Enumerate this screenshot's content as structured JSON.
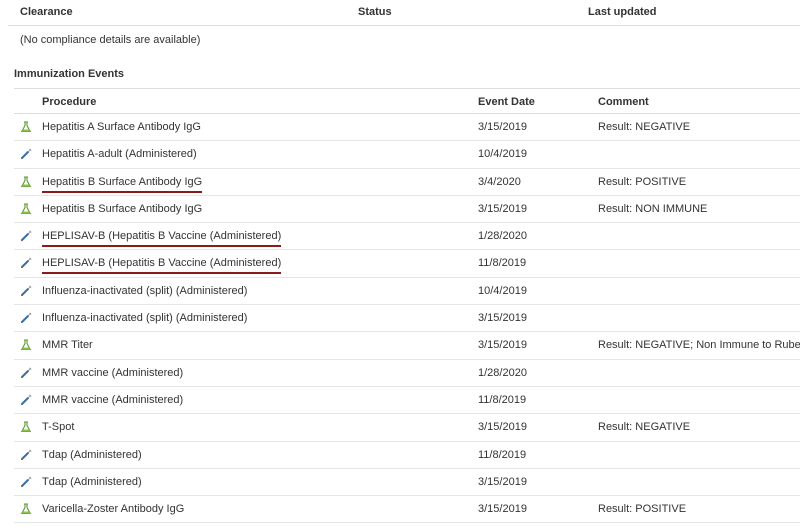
{
  "clearance": {
    "headers": {
      "clearance": "Clearance",
      "status": "Status",
      "last_updated": "Last updated"
    },
    "empty_message": "(No compliance details are available)"
  },
  "immunization": {
    "title": "Immunization Events",
    "headers": {
      "procedure": "Procedure",
      "event_date": "Event Date",
      "comment": "Comment"
    },
    "rows": [
      {
        "icon": "flask-icon",
        "procedure": "Hepatitis A Surface Antibody IgG",
        "date": "3/15/2019",
        "comment": "Result: NEGATIVE",
        "underlined": false
      },
      {
        "icon": "syringe-icon",
        "procedure": "Hepatitis A-adult (Administered)",
        "date": "10/4/2019",
        "comment": "",
        "underlined": false
      },
      {
        "icon": "flask-icon",
        "procedure": "Hepatitis B Surface Antibody IgG",
        "date": "3/4/2020",
        "comment": "Result: POSITIVE",
        "underlined": true
      },
      {
        "icon": "flask-icon",
        "procedure": "Hepatitis B Surface Antibody IgG",
        "date": "3/15/2019",
        "comment": "Result: NON IMMUNE",
        "underlined": false
      },
      {
        "icon": "syringe-icon",
        "procedure": "HEPLISAV-B (Hepatitis B Vaccine (Administered)",
        "date": "1/28/2020",
        "comment": "",
        "underlined": true
      },
      {
        "icon": "syringe-icon",
        "procedure": "HEPLISAV-B (Hepatitis B Vaccine (Administered)",
        "date": "11/8/2019",
        "comment": "",
        "underlined": true
      },
      {
        "icon": "syringe-icon",
        "procedure": "Influenza-inactivated (split) (Administered)",
        "date": "10/4/2019",
        "comment": "",
        "underlined": false
      },
      {
        "icon": "syringe-icon",
        "procedure": "Influenza-inactivated (split) (Administered)",
        "date": "3/15/2019",
        "comment": "",
        "underlined": false
      },
      {
        "icon": "flask-icon",
        "procedure": "MMR Titer",
        "date": "3/15/2019",
        "comment": "Result: NEGATIVE; Non Immune to Rubeola",
        "underlined": false
      },
      {
        "icon": "syringe-icon",
        "procedure": "MMR vaccine (Administered)",
        "date": "1/28/2020",
        "comment": "",
        "underlined": false
      },
      {
        "icon": "syringe-icon",
        "procedure": "MMR vaccine (Administered)",
        "date": "11/8/2019",
        "comment": "",
        "underlined": false
      },
      {
        "icon": "flask-icon",
        "procedure": "T-Spot",
        "date": "3/15/2019",
        "comment": "Result: NEGATIVE",
        "underlined": false
      },
      {
        "icon": "syringe-icon",
        "procedure": "Tdap (Administered)",
        "date": "11/8/2019",
        "comment": "",
        "underlined": false
      },
      {
        "icon": "syringe-icon",
        "procedure": "Tdap (Administered)",
        "date": "3/15/2019",
        "comment": "",
        "underlined": false
      },
      {
        "icon": "flask-icon",
        "procedure": "Varicella-Zoster Antibody IgG",
        "date": "3/15/2019",
        "comment": "Result: POSITIVE",
        "underlined": false
      }
    ]
  },
  "colors": {
    "underline": "#8b1a1a",
    "flask": "#5a9a2e",
    "syringe": "#3a6ea5"
  }
}
